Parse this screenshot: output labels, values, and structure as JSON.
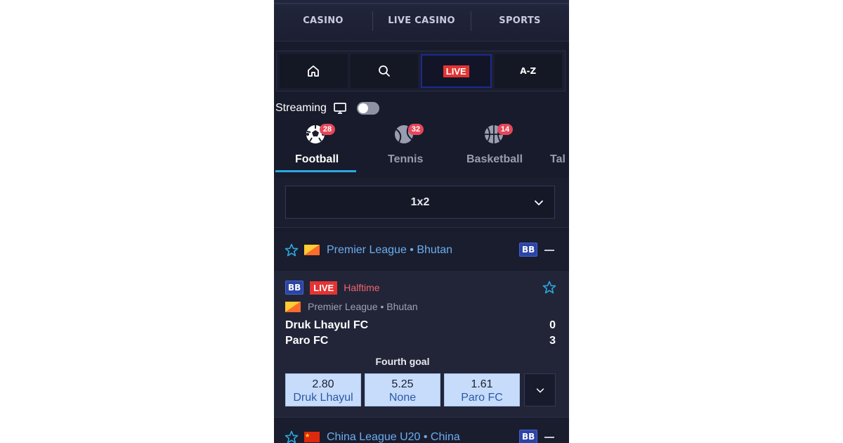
{
  "top_tabs": [
    "CASINO",
    "LIVE CASINO",
    "SPORTS"
  ],
  "icon_nav": {
    "home_icon": "home-icon",
    "search_icon": "search-icon",
    "live_label": "LIVE",
    "az_label": "A-Z"
  },
  "streaming": {
    "label": "Streaming",
    "enabled": false
  },
  "sports": [
    {
      "label": "Football",
      "count": "28",
      "icon": "football-icon",
      "active": true
    },
    {
      "label": "Tennis",
      "count": "32",
      "icon": "tennis-icon",
      "active": false
    },
    {
      "label": "Basketball",
      "count": "14",
      "icon": "basketball-icon",
      "active": false
    },
    {
      "label": "Tal",
      "count": "",
      "icon": "",
      "active": false
    }
  ],
  "market_select": {
    "value": "1x2"
  },
  "leagues": [
    {
      "name": "Premier League • Bhutan",
      "badge": "BB",
      "flag": "bhutan-flag"
    },
    {
      "name": "China League U20 • China",
      "badge": "BB",
      "flag": "china-flag"
    }
  ],
  "event": {
    "badge": "BB",
    "live_label": "LIVE",
    "status": "Halftime",
    "league": "Premier League • Bhutan",
    "home_team": "Druk Lhayul FC",
    "away_team": "Paro FC",
    "home_score": "0",
    "away_score": "3",
    "market_title": "Fourth goal",
    "odds": [
      {
        "value": "2.80",
        "label": "Druk Lhayul"
      },
      {
        "value": "5.25",
        "label": "None"
      },
      {
        "value": "1.61",
        "label": "Paro FC"
      }
    ]
  },
  "colors": {
    "background": "#181b2b",
    "accent_blue": "#2ba8e0",
    "live_red": "#e33434",
    "league_link": "#6aaef0",
    "odd_button": "#c6dcfa"
  }
}
